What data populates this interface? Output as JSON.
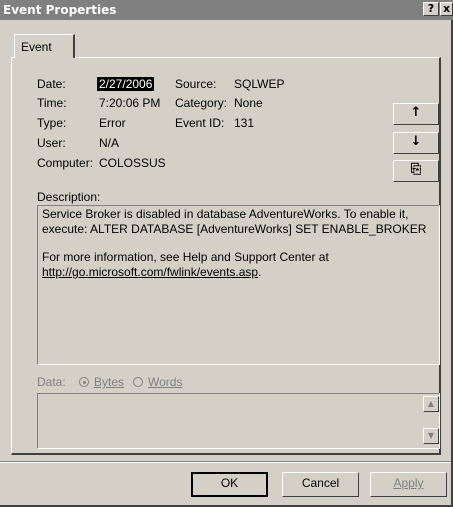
{
  "window": {
    "title": "Event Properties",
    "help_label": "?",
    "close_label": "x"
  },
  "tabs": [
    {
      "label": "Event",
      "active": true
    }
  ],
  "fields": {
    "date_label": "Date:",
    "date_value": "2/27/2006",
    "time_label": "Time:",
    "time_value": "7:20:06 PM",
    "type_label": "Type:",
    "type_value": "Error",
    "user_label": "User:",
    "user_value": "N/A",
    "computer_label": "Computer:",
    "computer_value": "COLOSSUS",
    "source_label": "Source:",
    "source_value": "SQLWEP",
    "category_label": "Category:",
    "category_value": "None",
    "event_id_label": "Event ID:",
    "event_id_value": "131"
  },
  "side_buttons": {
    "up_label": "↑",
    "down_label": "↓",
    "copy_label": "⎘"
  },
  "description": {
    "label": "Description:",
    "line1": "Service Broker is disabled in database AdventureWorks. To enable it,",
    "line2": "execute: ALTER DATABASE [AdventureWorks] SET ENABLE_BROKER",
    "line3": "For more information, see Help and Support Center at",
    "link": "http://go.microsoft.com/fwlink/events.asp",
    "link_suffix": "."
  },
  "data_section": {
    "label": "Data:",
    "bytes_label": "Bytes",
    "words_label": "Words",
    "selected": "Bytes"
  },
  "footer": {
    "ok_label": "OK",
    "cancel_label": "Cancel",
    "apply_label": "Apply"
  }
}
